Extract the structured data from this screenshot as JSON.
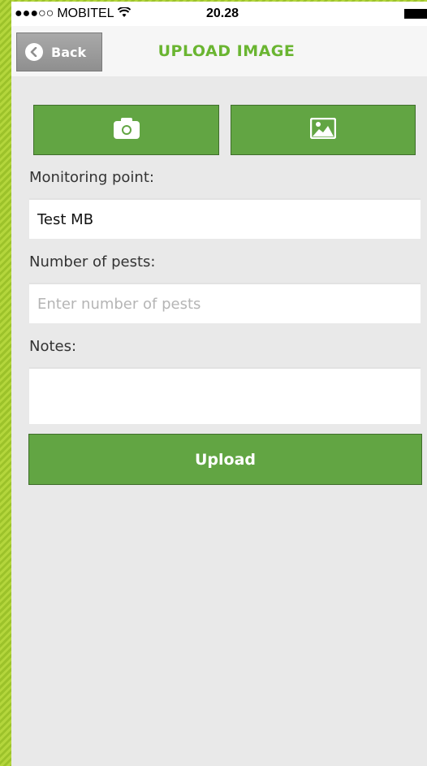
{
  "status_bar": {
    "signal": "●●●○○",
    "carrier": "MOBITEL",
    "wifi_icon": "wifi-icon",
    "time": "20.28"
  },
  "nav": {
    "back_label": "Back",
    "title": "UPLOAD IMAGE"
  },
  "actions": {
    "camera_icon": "camera-icon",
    "gallery_icon": "image-icon"
  },
  "form": {
    "monitoring_label": "Monitoring point:",
    "monitoring_value": "Test MB",
    "pests_label": "Number of pests:",
    "pests_placeholder": "Enter number of pests",
    "notes_label": "Notes:",
    "notes_value": ""
  },
  "upload_label": "Upload",
  "colors": {
    "accent_green": "#62a543",
    "title_green": "#6ab531",
    "stripe_green": "#b4d63c"
  }
}
